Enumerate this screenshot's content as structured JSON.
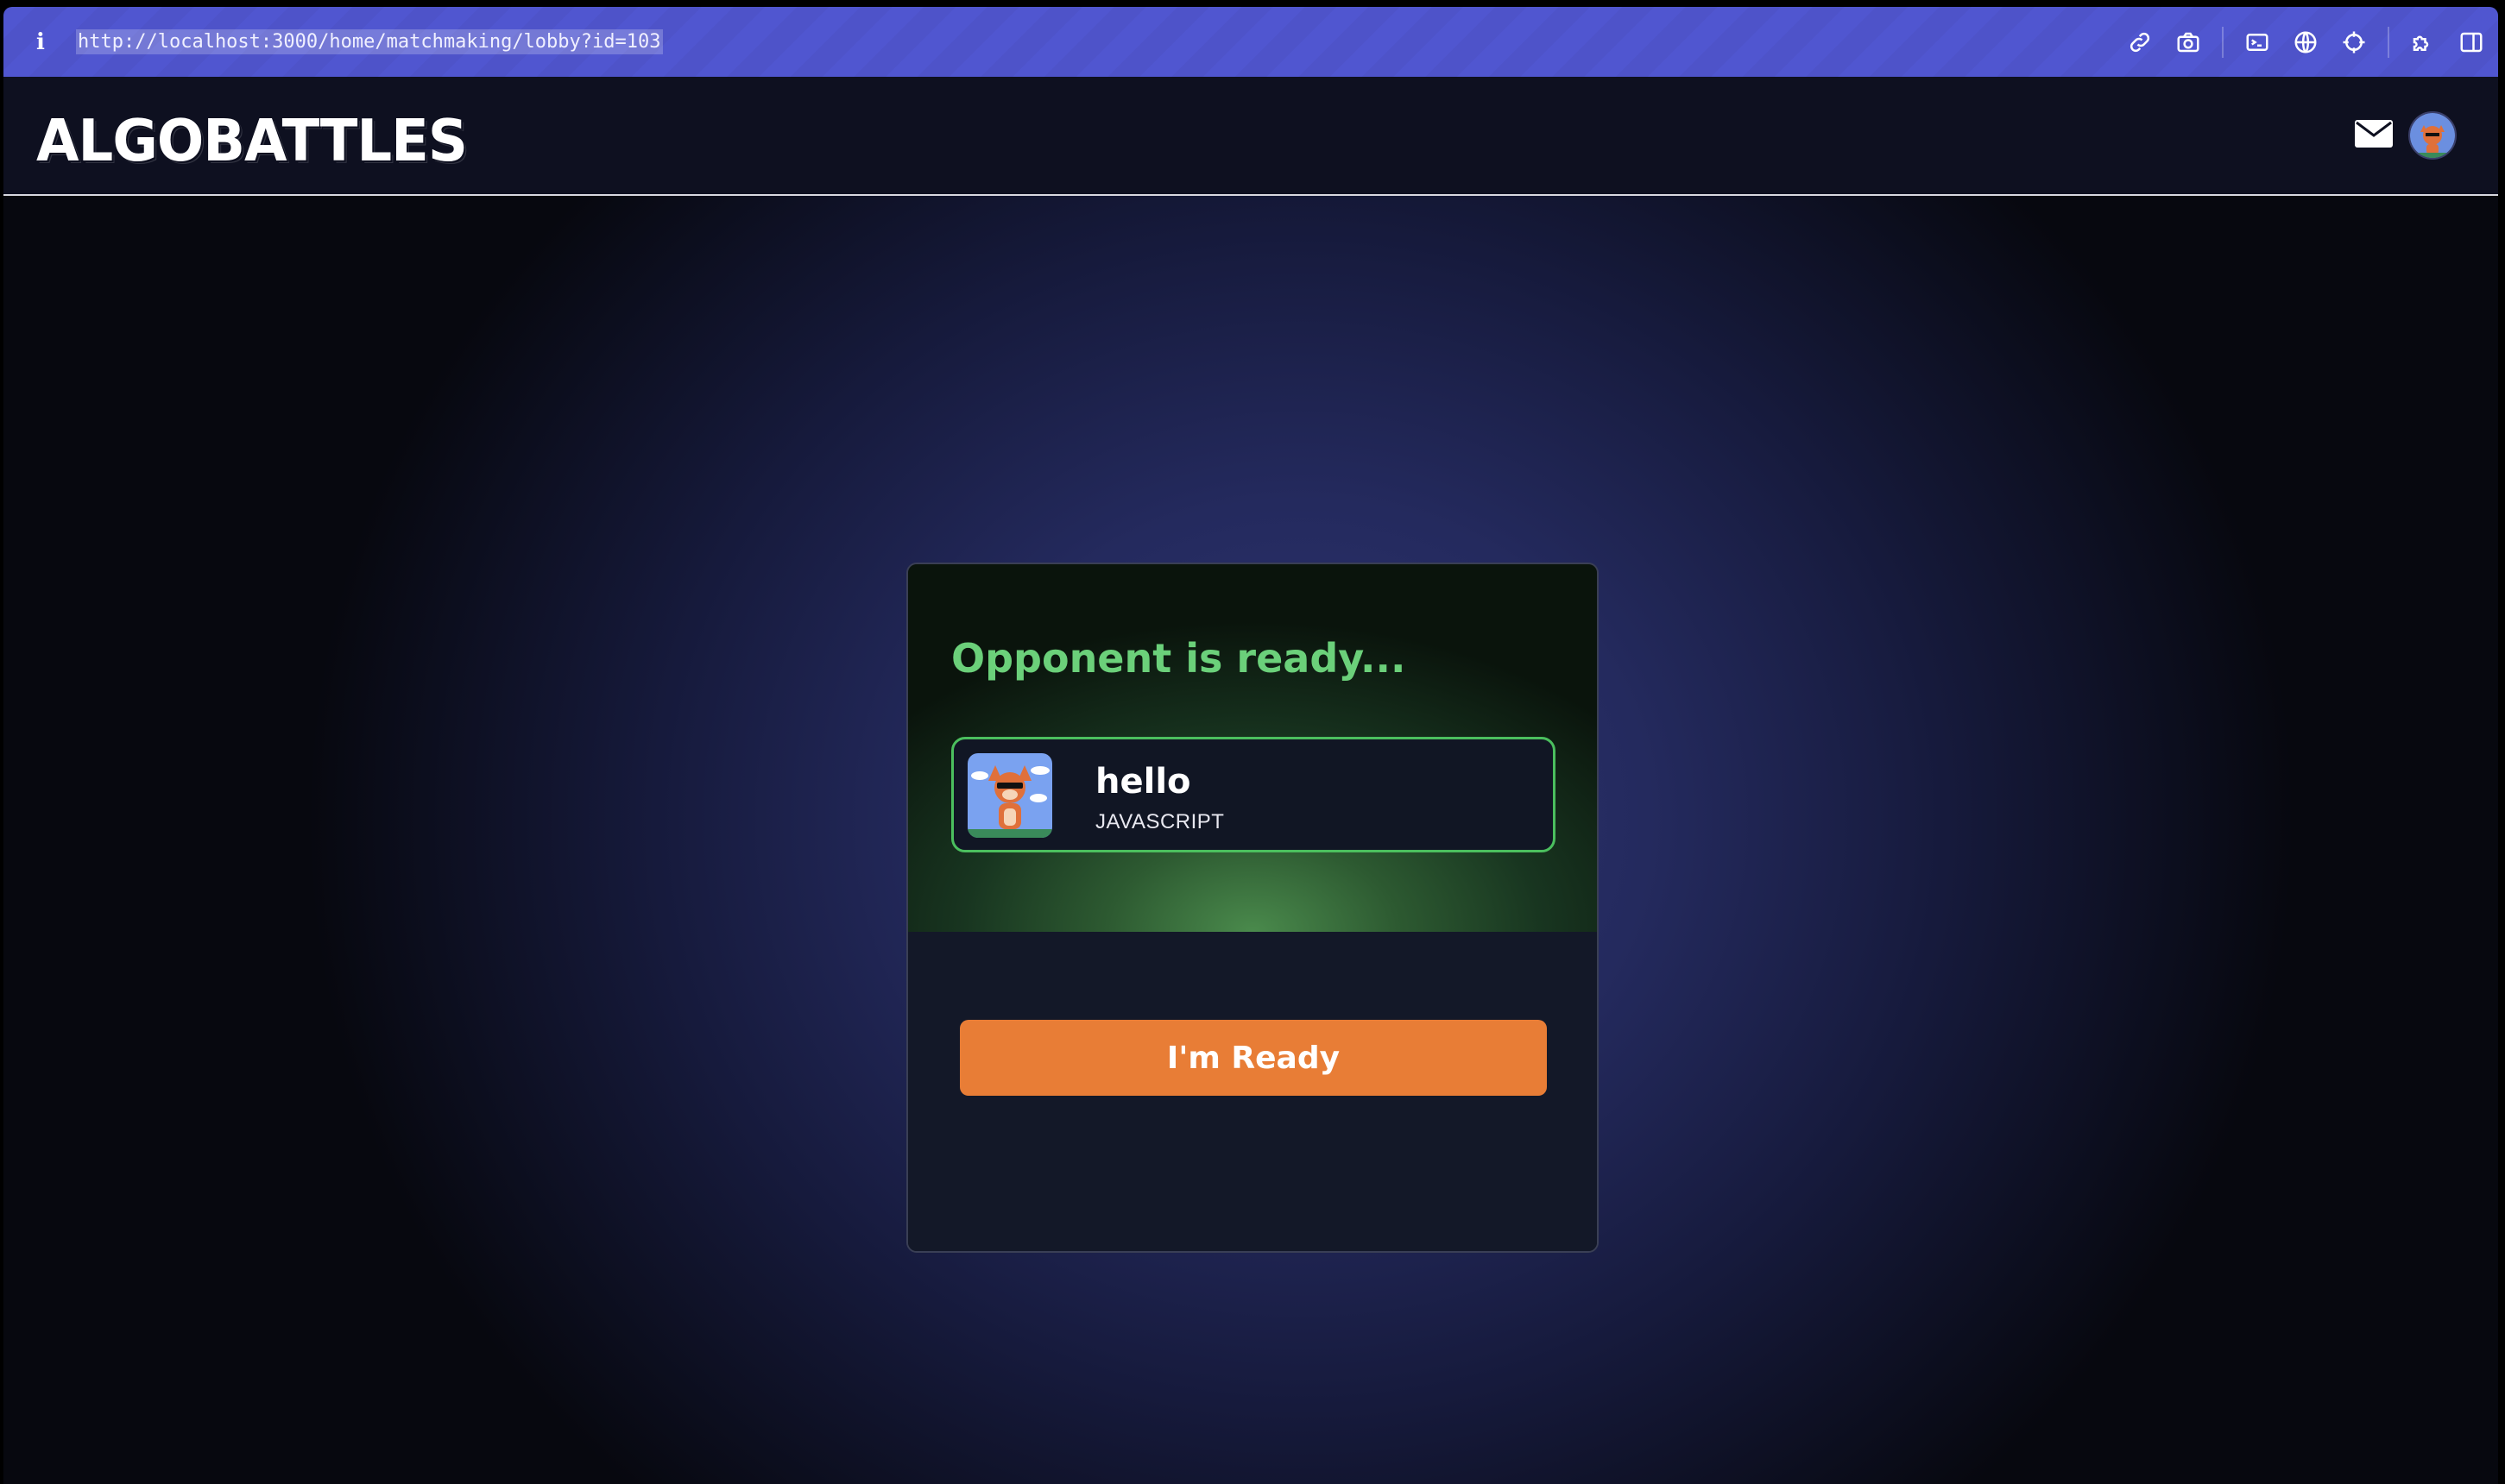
{
  "browser": {
    "url": "http://localhost:3000/home/matchmaking/lobby?id=103",
    "info_icon": "info-icon",
    "tools": [
      "link-icon",
      "camera-icon",
      "terminal-icon",
      "globe-icon",
      "crosshair-icon",
      "puzzle-icon",
      "sidebar-icon"
    ]
  },
  "navbar": {
    "logo": "ALGOBATTLES",
    "icons": [
      "mail-icon",
      "avatar"
    ]
  },
  "lobby": {
    "status": "Opponent is ready...",
    "opponent": {
      "name": "hello",
      "language": "JAVASCRIPT"
    },
    "ready_button": "I'm Ready"
  },
  "colors": {
    "accent_orange": "#e87d36",
    "ready_green": "#6bd07a",
    "browser_bar": "#5056d0"
  }
}
